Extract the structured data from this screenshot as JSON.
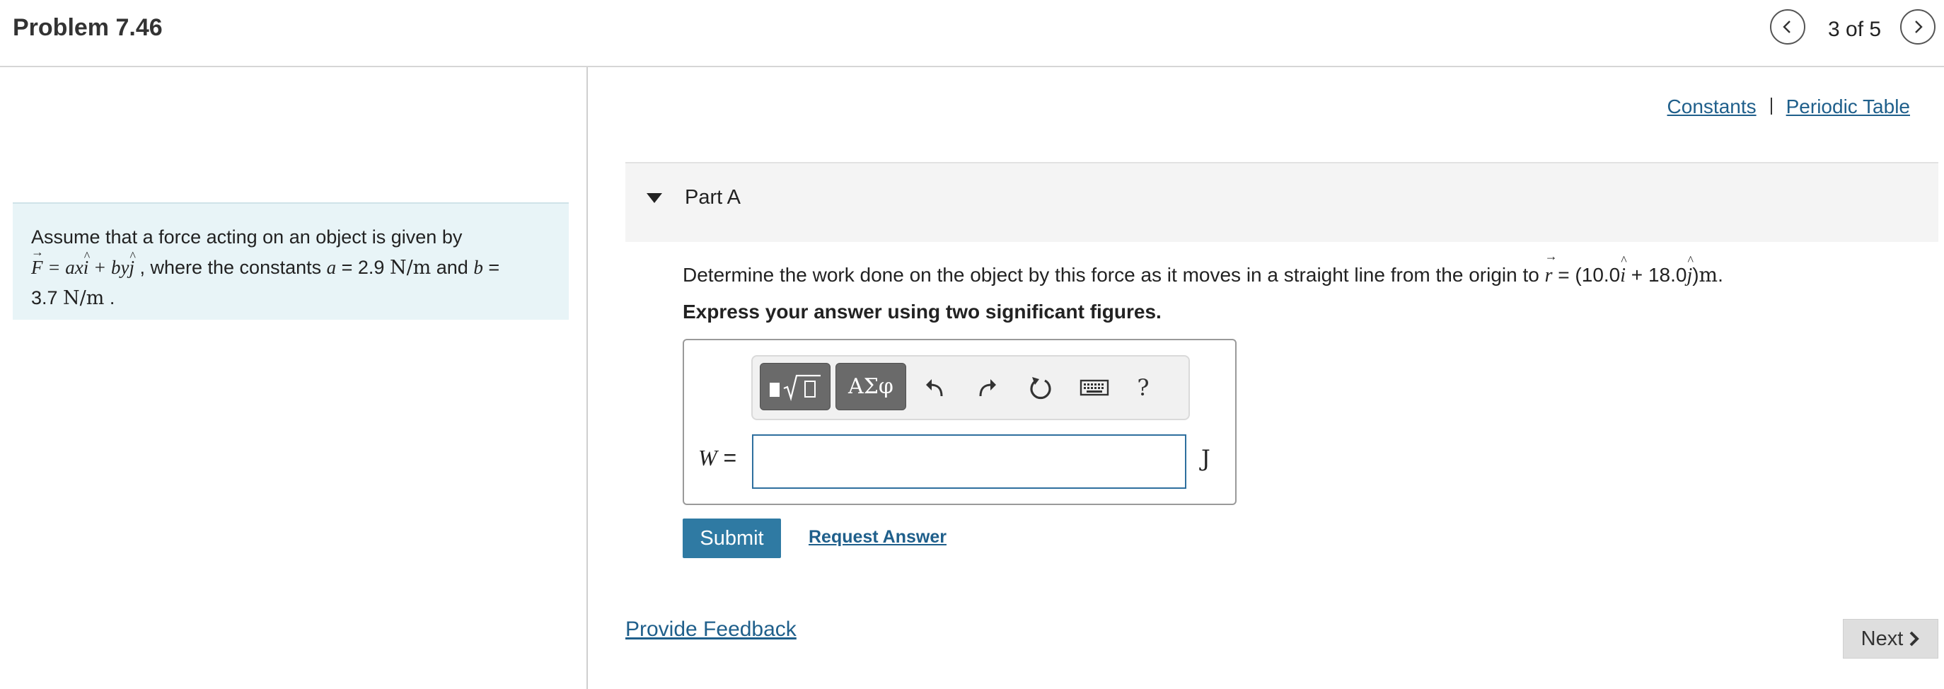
{
  "header": {
    "title": "Problem 7.46",
    "counter": "3 of 5"
  },
  "problem": {
    "intro": "Assume that a force acting on an object is given by",
    "force_vec": "F",
    "equals_expr": " = ax",
    "plus_expr": " + by",
    "i_hat": "i",
    "j_hat": "j",
    "where_text": " , where the constants ",
    "a_var": "a",
    "a_value": " = 2.9 ",
    "a_unit": "N/m",
    "and_text": " and ",
    "b_var": "b",
    "b_equals": " =",
    "b_value": "3.7 ",
    "b_unit": "N/m",
    "b_end": " ."
  },
  "links": {
    "constants": "Constants",
    "periodic_table": "Periodic Table"
  },
  "part": {
    "title": "Part A",
    "question_text": "Determine the work done on the object by this force as it moves in a straight line from the origin to ",
    "r_vec": "r",
    "r_eq": " = (10.0",
    "i_hat": "i",
    "r_plus": " + 18.0",
    "j_hat": "j",
    "r_close": ")",
    "r_unit": "m",
    "r_period": ".",
    "instruction": "Express your answer using two significant figures."
  },
  "answer": {
    "variable": "W",
    "equals": " =",
    "input_value": "",
    "unit": "J",
    "toolbar": {
      "templates_icon": "templates-icon",
      "greek_label": "ΑΣφ",
      "help_label": "?"
    }
  },
  "actions": {
    "submit": "Submit",
    "request_answer": "Request Answer",
    "provide_feedback": "Provide Feedback",
    "next": "Next"
  }
}
